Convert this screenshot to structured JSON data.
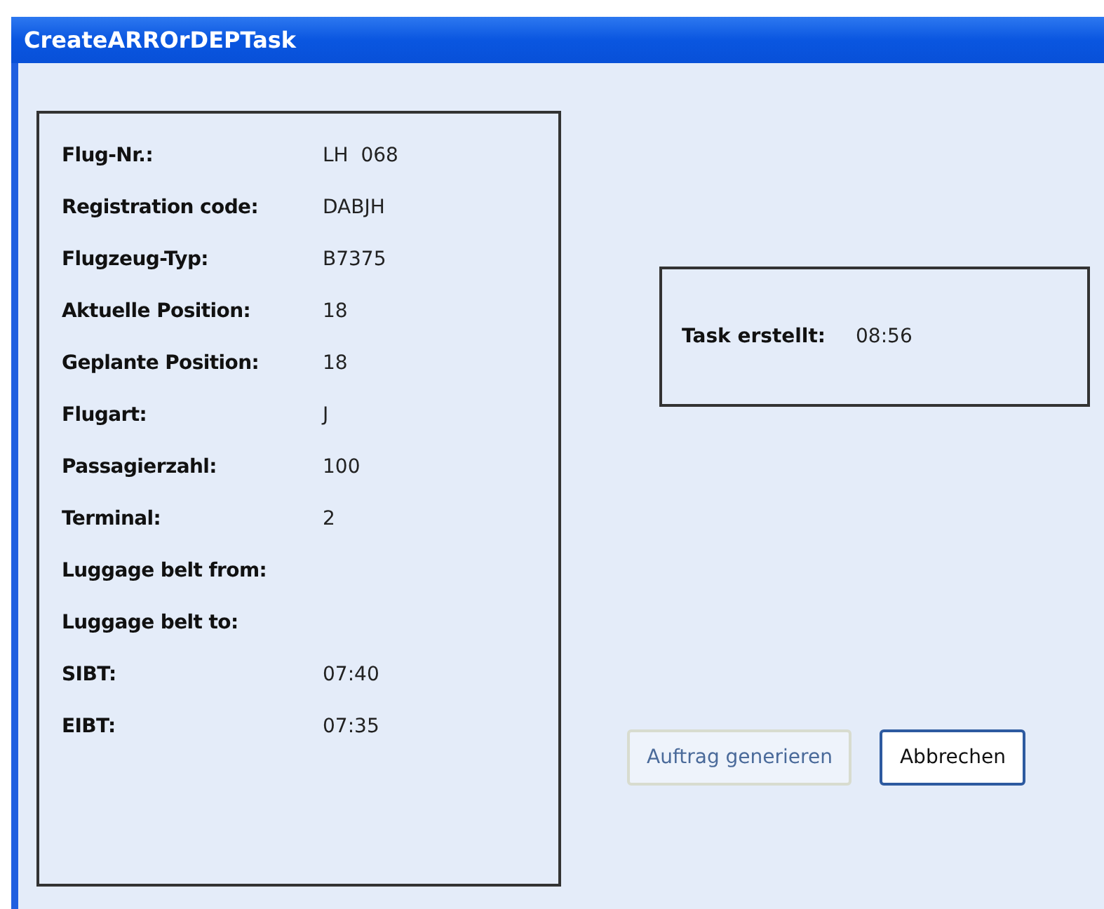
{
  "window": {
    "title": "CreateARROrDEPTask"
  },
  "fields": [
    {
      "label": "Flug-Nr.:",
      "value": "LH  068"
    },
    {
      "label": "Registration code:",
      "value": "DABJH"
    },
    {
      "label": "Flugzeug-Typ:",
      "value": "B7375"
    },
    {
      "label": "Aktuelle Position:",
      "value": "18"
    },
    {
      "label": "Geplante Position:",
      "value": "18"
    },
    {
      "label": "Flugart:",
      "value": "J"
    },
    {
      "label": "Passagierzahl:",
      "value": "100"
    },
    {
      "label": "Terminal:",
      "value": "2"
    },
    {
      "label": "Luggage belt from:"
    },
    {
      "label": "Luggage belt to:"
    },
    {
      "label": "SIBT:",
      "value": "07:40"
    },
    {
      "label": "EIBT:",
      "value": "07:35"
    }
  ],
  "task": {
    "label": "Task erstellt:",
    "value": "08:56"
  },
  "buttons": [
    {
      "label": "Auftrag generieren",
      "disabled": true
    },
    {
      "label": "Abbrechen",
      "disabled": false
    }
  ]
}
